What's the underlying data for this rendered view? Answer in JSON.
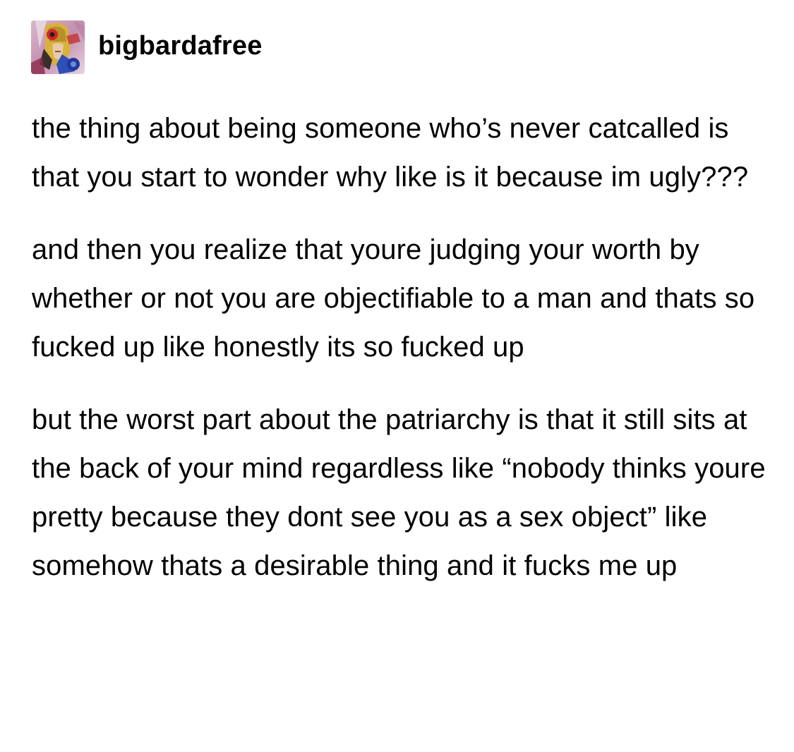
{
  "post": {
    "username": "bigbardafree",
    "avatar_icon": "barda-avatar-icon",
    "paragraphs": [
      "the thing about being someone who’s never catcalled is that you start to wonder why like is it because im ugly???",
      "and then you realize that youre judging your worth by whether or not you are objectifiable to a man and thats so fucked up like honestly its so fucked up",
      "but the worst part about the patriarchy is that it still sits at the back of your mind regardless like “nobody thinks youre pretty because they dont see you as a sex object” like somehow thats a desirable thing and it fucks me up"
    ]
  },
  "colors": {
    "background": "#ffffff",
    "text": "#000000"
  }
}
